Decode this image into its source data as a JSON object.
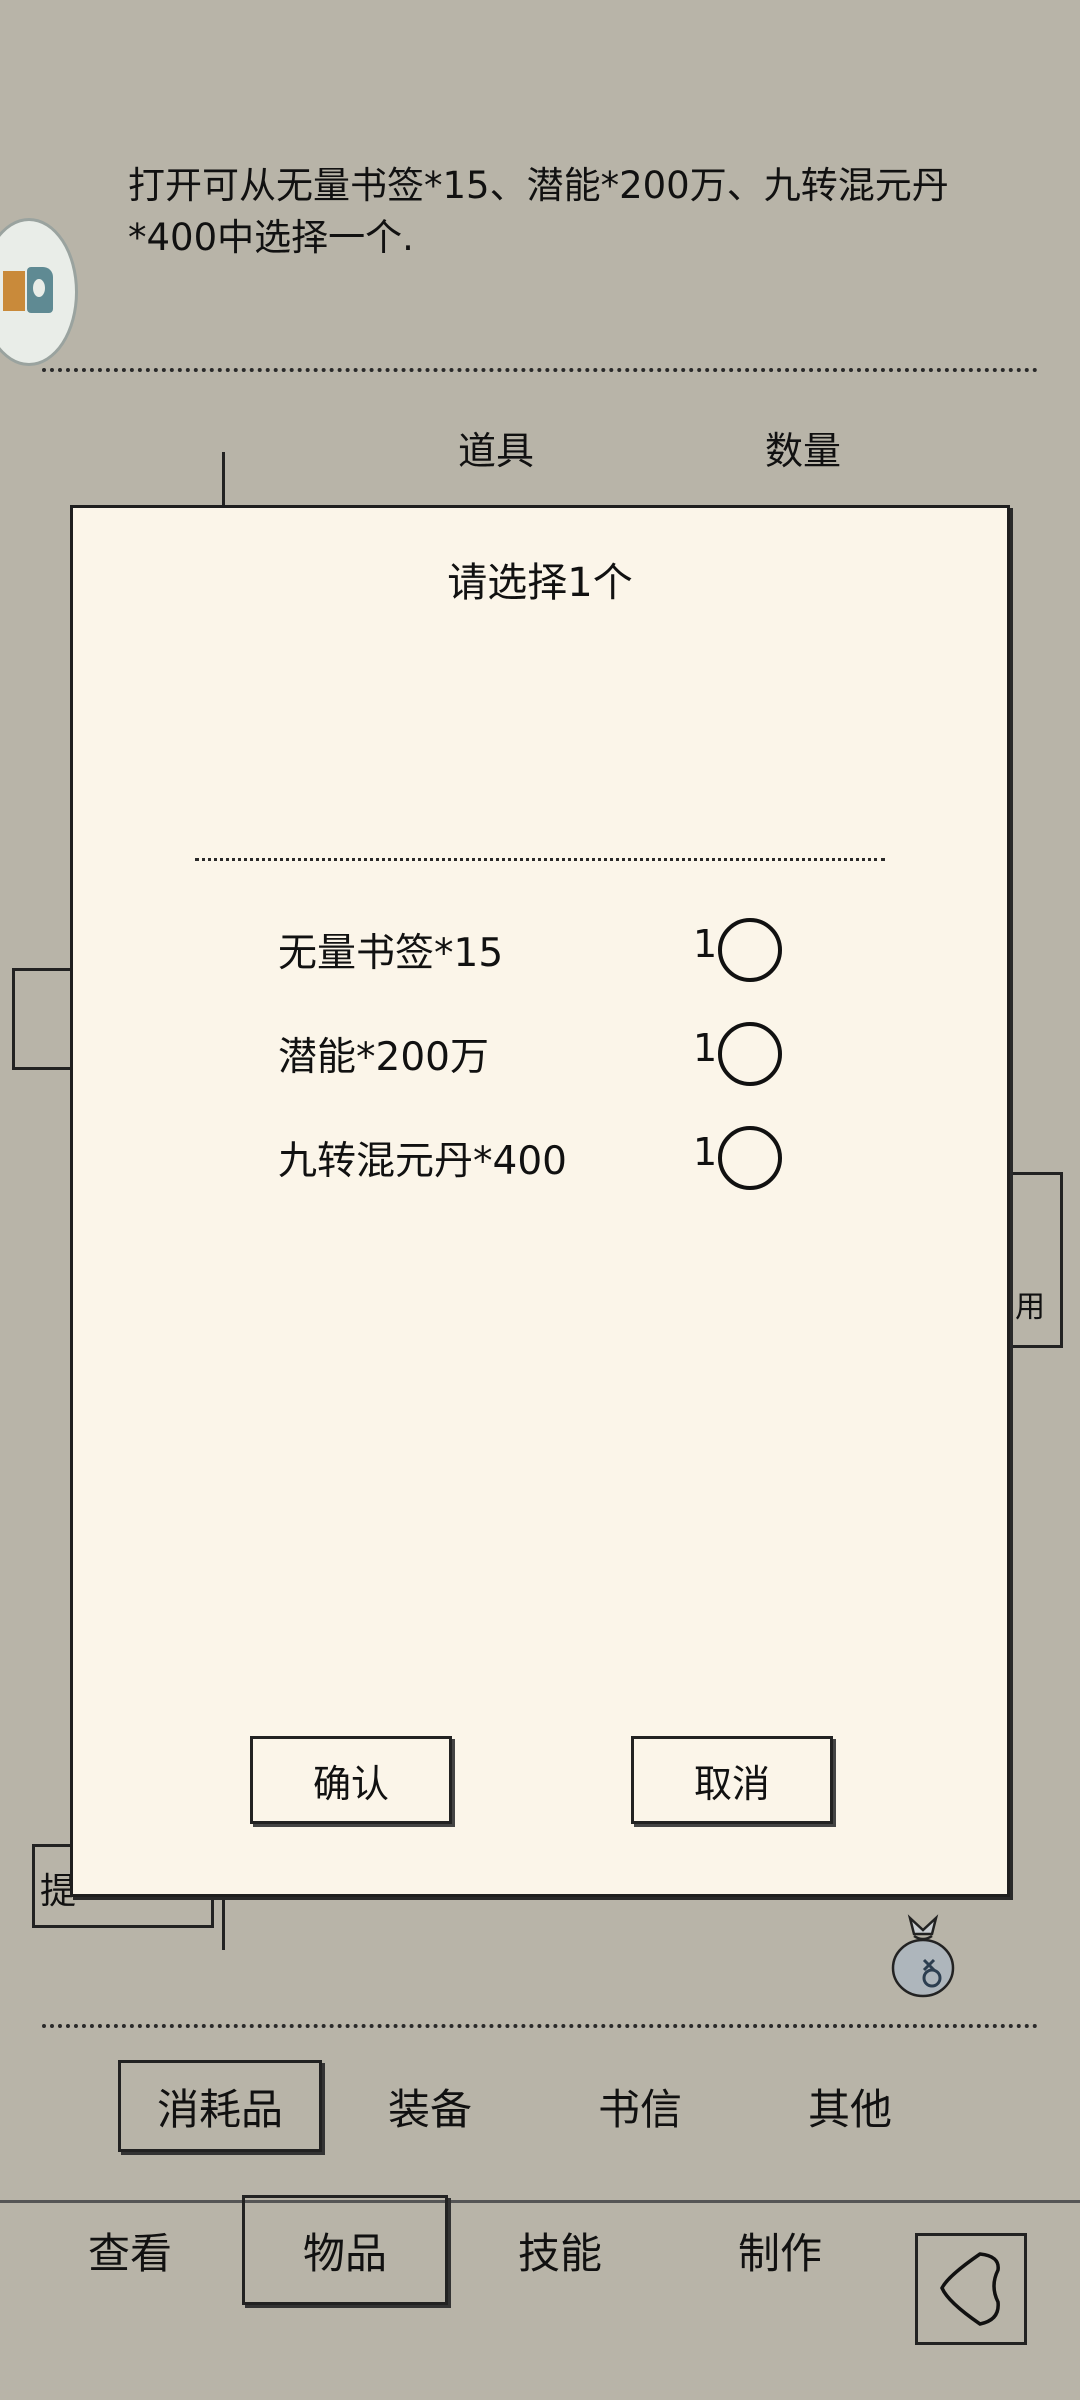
{
  "item_detail": {
    "description": "打开可从无量书签*15、潜能*200万、九转混元丹*400中选择一个."
  },
  "table_header": {
    "col_item": "道具",
    "col_quantity": "数量"
  },
  "background_buttons": {
    "use_partial": "用",
    "lift_partial": "提"
  },
  "dialog": {
    "title": "请选择1个",
    "options": [
      {
        "label": "无量书签*15",
        "count": "1",
        "selected": false
      },
      {
        "label": "潜能*200万",
        "count": "1",
        "selected": false
      },
      {
        "label": "九转混元丹*400",
        "count": "1",
        "selected": false
      }
    ],
    "confirm_label": "确认",
    "cancel_label": "取消"
  },
  "category_tabs": [
    {
      "label": "消耗品",
      "active": true
    },
    {
      "label": "装备",
      "active": false
    },
    {
      "label": "书信",
      "active": false
    },
    {
      "label": "其他",
      "active": false
    }
  ],
  "bottom_nav": [
    {
      "label": "查看",
      "active": false
    },
    {
      "label": "物品",
      "active": true
    },
    {
      "label": "技能",
      "active": false
    },
    {
      "label": "制作",
      "active": false
    }
  ],
  "icons": {
    "avatar_badge": "app-badge-icon",
    "bag": "money-bag-icon",
    "back": "back-arrow-icon"
  }
}
